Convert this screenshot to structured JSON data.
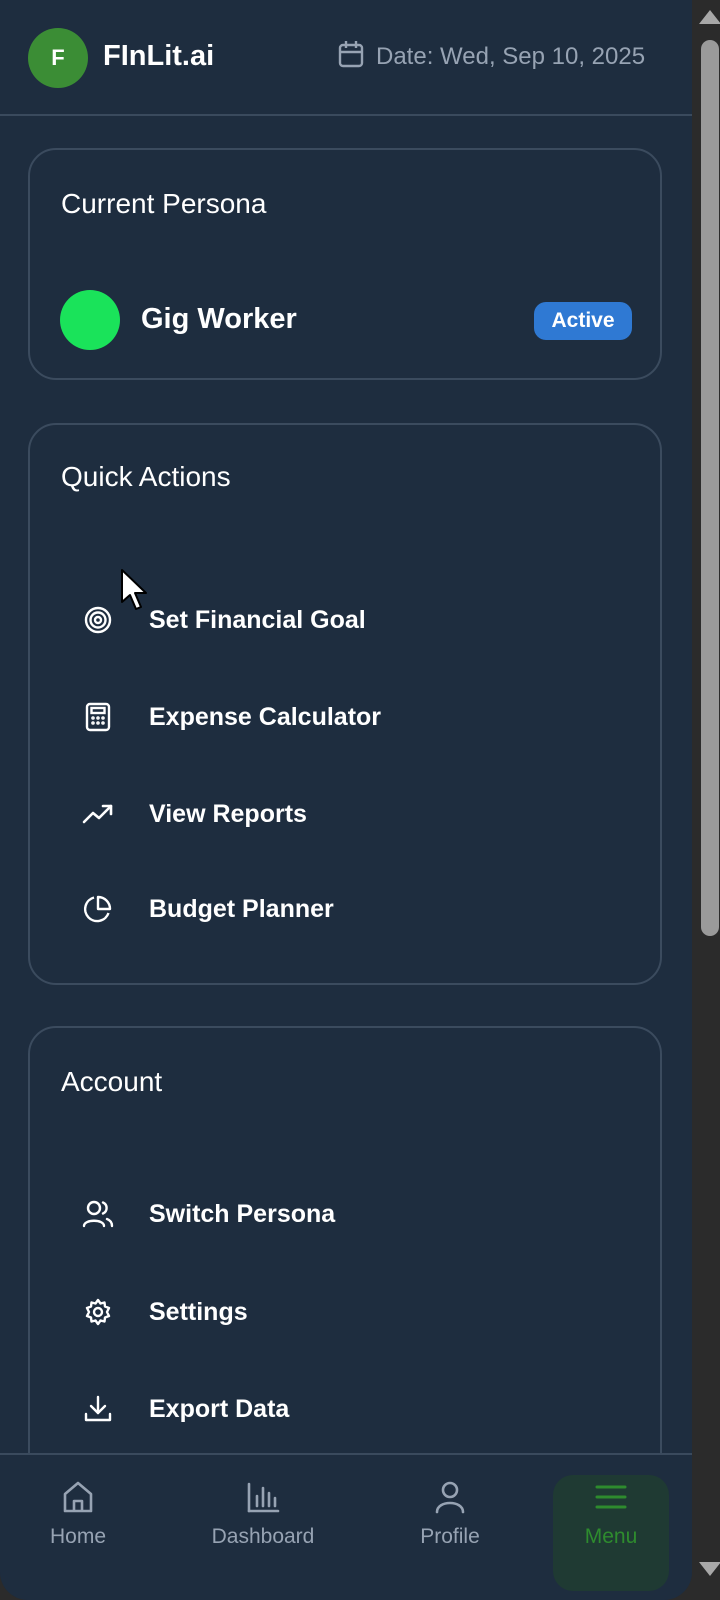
{
  "header": {
    "logo_letter": "F",
    "app_title": "FInLit.ai",
    "date_text": "Date: Wed, Sep 10, 2025"
  },
  "persona_card": {
    "title": "Current Persona",
    "persona_name": "Gig Worker",
    "status_badge": "Active",
    "dot_color": "#1ae35a"
  },
  "quick_actions": {
    "title": "Quick Actions",
    "items": [
      {
        "label": "Set Financial Goal",
        "icon": "target-icon"
      },
      {
        "label": "Expense Calculator",
        "icon": "calculator-icon"
      },
      {
        "label": "View Reports",
        "icon": "trending-up-icon"
      },
      {
        "label": "Budget Planner",
        "icon": "pie-chart-icon"
      }
    ]
  },
  "account": {
    "title": "Account",
    "items": [
      {
        "label": "Switch Persona",
        "icon": "users-icon"
      },
      {
        "label": "Settings",
        "icon": "gear-icon"
      },
      {
        "label": "Export Data",
        "icon": "download-icon"
      }
    ]
  },
  "bottom_nav": {
    "items": [
      {
        "label": "Home",
        "icon": "home-icon"
      },
      {
        "label": "Dashboard",
        "icon": "bar-chart-icon"
      },
      {
        "label": "Profile",
        "icon": "user-icon"
      },
      {
        "label": "Menu",
        "icon": "menu-icon",
        "active": true
      }
    ]
  },
  "colors": {
    "background": "#1e2d3f",
    "accent_green": "#3b8d35",
    "badge_blue": "#2f79d3",
    "active_nav": "#2e8b2e"
  }
}
